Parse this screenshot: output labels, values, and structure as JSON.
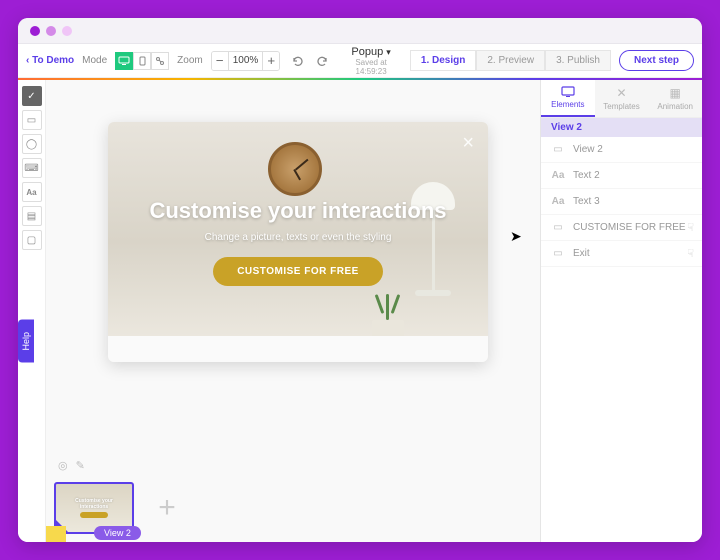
{
  "topbar": {
    "back_label": "‹ To Demo",
    "mode_label": "Mode",
    "zoom_label": "Zoom",
    "zoom_value": "100%",
    "center_title": "Popup",
    "center_subtitle": "Saved at 14:59:23",
    "steps": [
      "1. Design",
      "2. Preview",
      "3. Publish"
    ],
    "next_label": "Next step"
  },
  "popup": {
    "heading": "Customise your interactions",
    "subtext": "Change a picture, texts or even the styling",
    "cta": "CUSTOMISE FOR FREE"
  },
  "panel": {
    "tabs": [
      "Elements",
      "Templates",
      "Animation"
    ],
    "header": "View 2",
    "layers": [
      {
        "icon": "monitor",
        "label": "View 2"
      },
      {
        "icon": "Aa",
        "label": "Text 2"
      },
      {
        "icon": "Aa",
        "label": "Text 3"
      },
      {
        "icon": "button",
        "label": "CUSTOMISE FOR FREE",
        "hand": true
      },
      {
        "icon": "button",
        "label": "Exit",
        "hand": true
      }
    ]
  },
  "footer": {
    "view_chip": "View 2"
  },
  "help_label": "Help"
}
